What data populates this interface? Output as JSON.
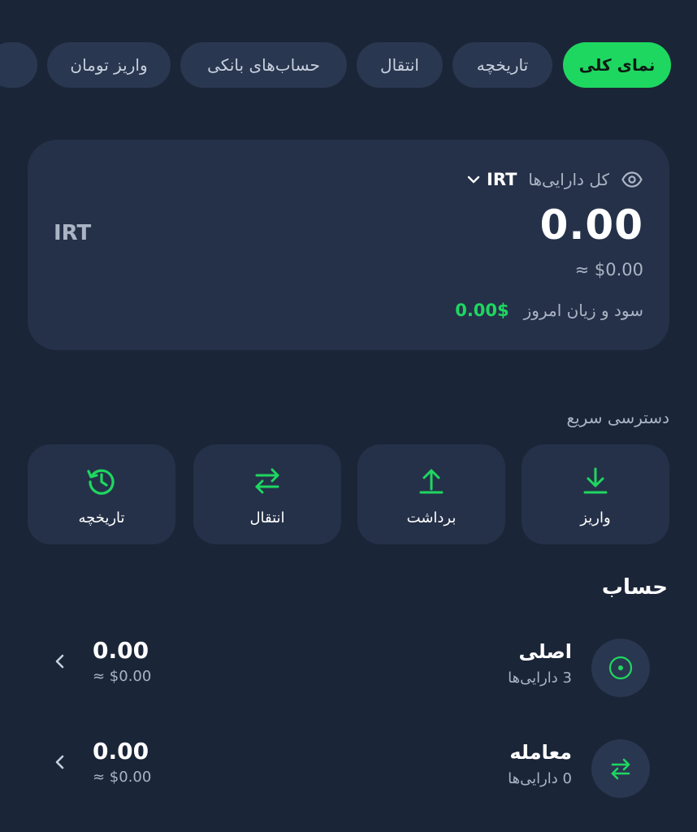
{
  "tabs": [
    {
      "label": "نمای کلی",
      "active": true
    },
    {
      "label": "تاریخچه",
      "active": false
    },
    {
      "label": "انتقال",
      "active": false
    },
    {
      "label": "حساب‌های بانکی",
      "active": false
    },
    {
      "label": "واریز تومان",
      "active": false
    }
  ],
  "balance": {
    "label": "کل دارایی‌ها",
    "currency": "IRT",
    "amount": "0.00",
    "unit": "IRT",
    "approx": "≈ $0.00",
    "pnl_label": "سود و زیان امروز",
    "pnl_value": "0.00$",
    "visibility_icon": "eye-icon",
    "dropdown_icon": "chevron-down-icon"
  },
  "quick_access": {
    "title": "دسترسی سریع",
    "items": [
      {
        "label": "واریز",
        "icon": "download-icon"
      },
      {
        "label": "برداشت",
        "icon": "upload-icon"
      },
      {
        "label": "انتقال",
        "icon": "transfer-icon"
      },
      {
        "label": "تاریخچه",
        "icon": "history-icon"
      }
    ]
  },
  "accounts": {
    "title": "حساب",
    "items": [
      {
        "name": "اصلی",
        "sub": "3 دارایی‌ها",
        "amount": "0.00",
        "approx": "≈ $0.00",
        "icon": "target-icon"
      },
      {
        "name": "معامله",
        "sub": "0 دارایی‌ها",
        "amount": "0.00",
        "approx": "≈ $0.00",
        "icon": "exchange-icon"
      }
    ]
  },
  "colors": {
    "background": "#1b2538",
    "card": "#253149",
    "accent": "#1ed760",
    "muted": "#aab4c4"
  }
}
